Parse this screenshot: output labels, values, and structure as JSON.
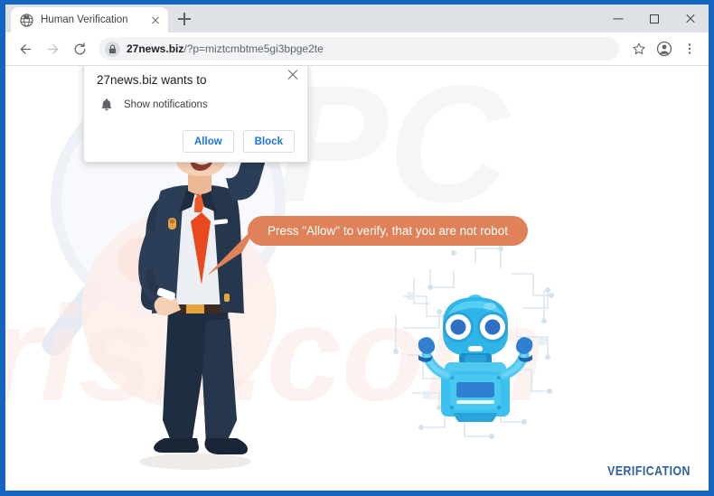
{
  "window": {
    "controls": [
      {
        "name": "minimize",
        "label": "–"
      },
      {
        "name": "maximize",
        "label": "□"
      },
      {
        "name": "close",
        "label": "✕"
      }
    ]
  },
  "tabs": [
    {
      "title": "Human Verification",
      "favicon": "globe-icon",
      "close_label": "✕"
    }
  ],
  "newtab_label": "+",
  "toolbar": {
    "back_label": "←",
    "forward_label": "→",
    "reload_label": "⟳",
    "url_host": "27news.biz",
    "url_path": "/?p=miztcmbtme5gi3bpge2te",
    "lock_icon": "lock-icon",
    "bookmark_icon": "star-icon",
    "profile_icon": "account-avatar-icon",
    "menu_icon": "three-dot-menu-icon"
  },
  "permission_dialog": {
    "title": "27news.biz wants to",
    "permission_icon": "bell-icon",
    "permission_label": "Show notifications",
    "allow_label": "Allow",
    "block_label": "Block",
    "close_label": "✕"
  },
  "page": {
    "speech_bubble_text": "Press \"Allow\" to verify, that you are not robot",
    "speech_bubble_color": "#e08259",
    "footer_wordmark": "VERIFICATION",
    "footer_wordmark_color": "#2c5f9e",
    "watermark_text": "pcrisk.com",
    "illustrations": [
      {
        "name": "businessman-pointing",
        "description": "cartoon businessman in navy suit with orange tie pointing upward"
      },
      {
        "name": "friendly-robot",
        "description": "cyan robot with two large eyes and raised arms on circuit background"
      },
      {
        "name": "magnifier-shape",
        "description": "large pale blue magnifying glass background shape"
      }
    ]
  },
  "theme": {
    "frame_blue": "#1565c0",
    "tabstrip_grey": "#dee1e6",
    "link_blue": "#1a73e8",
    "suit_navy": "#26364d",
    "tie_orange": "#e8491f",
    "robot_cyan": "#29b6ea"
  }
}
